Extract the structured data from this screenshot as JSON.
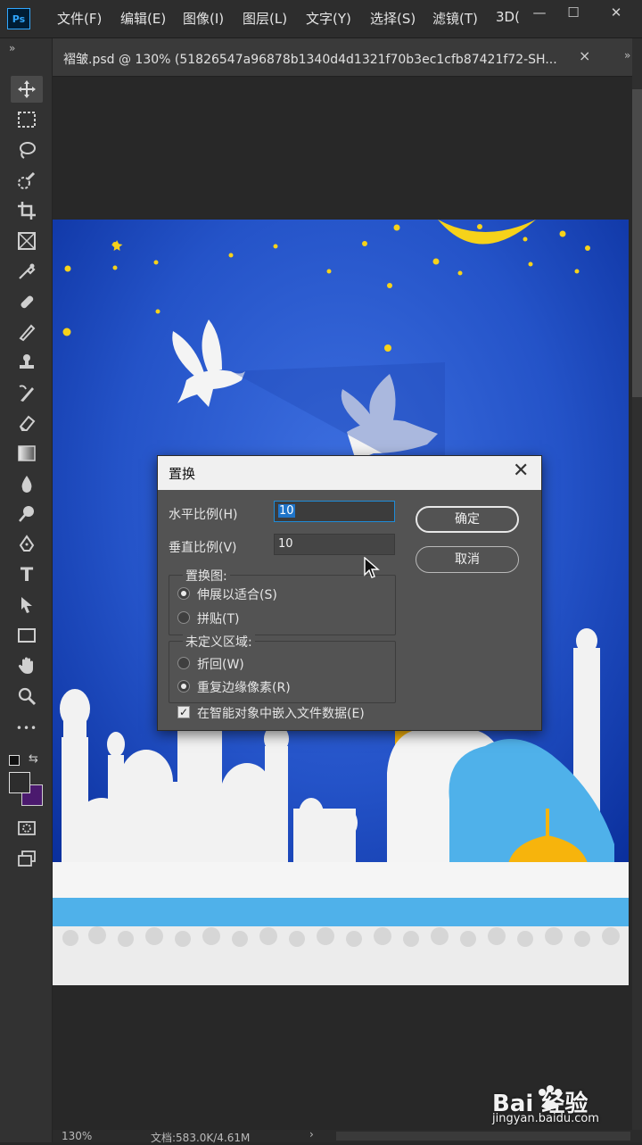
{
  "app": {
    "logo": "Ps",
    "menu": [
      "文件(F)",
      "编辑(E)",
      "图像(I)",
      "图层(L)",
      "文字(Y)",
      "选择(S)",
      "滤镜(T)",
      "3D("
    ],
    "window_buttons": {
      "minimize": "—",
      "maximize": "☐",
      "close": "✕"
    }
  },
  "document": {
    "tab_label": "褶皱.psd @ 130% (51826547a96878b1340d4d1321f70b3ec1cfb87421f72-SH...",
    "tab_close": "×"
  },
  "toolbar": {
    "collapse": "»",
    "tools": [
      "move-icon",
      "marquee-icon",
      "lasso-icon",
      "quick-select-icon",
      "crop-icon",
      "frame-icon",
      "eyedropper-icon",
      "healing-icon",
      "brush-icon",
      "stamp-icon",
      "history-brush-icon",
      "eraser-icon",
      "gradient-icon",
      "blur-icon",
      "dodge-icon",
      "pen-icon",
      "type-icon",
      "path-select-icon",
      "rectangle-icon",
      "hand-icon",
      "zoom-icon",
      "more-icon"
    ],
    "type_tool_glyph": "T",
    "more_glyph": "•••",
    "foreground_color": "#2d2d2d",
    "background_color": "#4b1a6e"
  },
  "dialog": {
    "title": "置换",
    "close": "✕",
    "horizontal_label": "水平比例(H)",
    "horizontal_value": "10",
    "vertical_label": "垂直比例(V)",
    "vertical_value": "10",
    "ok_label": "确定",
    "cancel_label": "取消",
    "displacement_map": {
      "title": "置换图:",
      "options": [
        {
          "label": "伸展以适合(S)",
          "selected": true
        },
        {
          "label": "拼贴(T)",
          "selected": false
        }
      ]
    },
    "undefined_areas": {
      "title": "未定义区域:",
      "options": [
        {
          "label": "折回(W)",
          "selected": false
        },
        {
          "label": "重复边缘像素(R)",
          "selected": true
        }
      ]
    },
    "embed_checkbox": {
      "label": "在智能对象中嵌入文件数据(E)",
      "checked": true
    }
  },
  "status": {
    "zoom": "130%",
    "doc_info": "文档:583.0K/4.61M",
    "arrow": "›"
  },
  "watermark": {
    "logo": "Bai  经验",
    "url": "jingyan.baidu.com"
  },
  "colors": {
    "sky_center": "#3d6fe0",
    "sky_edge": "#0a2f9c",
    "moon": "#f6d21a",
    "dome_light_blue": "#4fb1ea",
    "dome_yellow": "#f7b40c",
    "building_white": "#f2f2f2"
  }
}
